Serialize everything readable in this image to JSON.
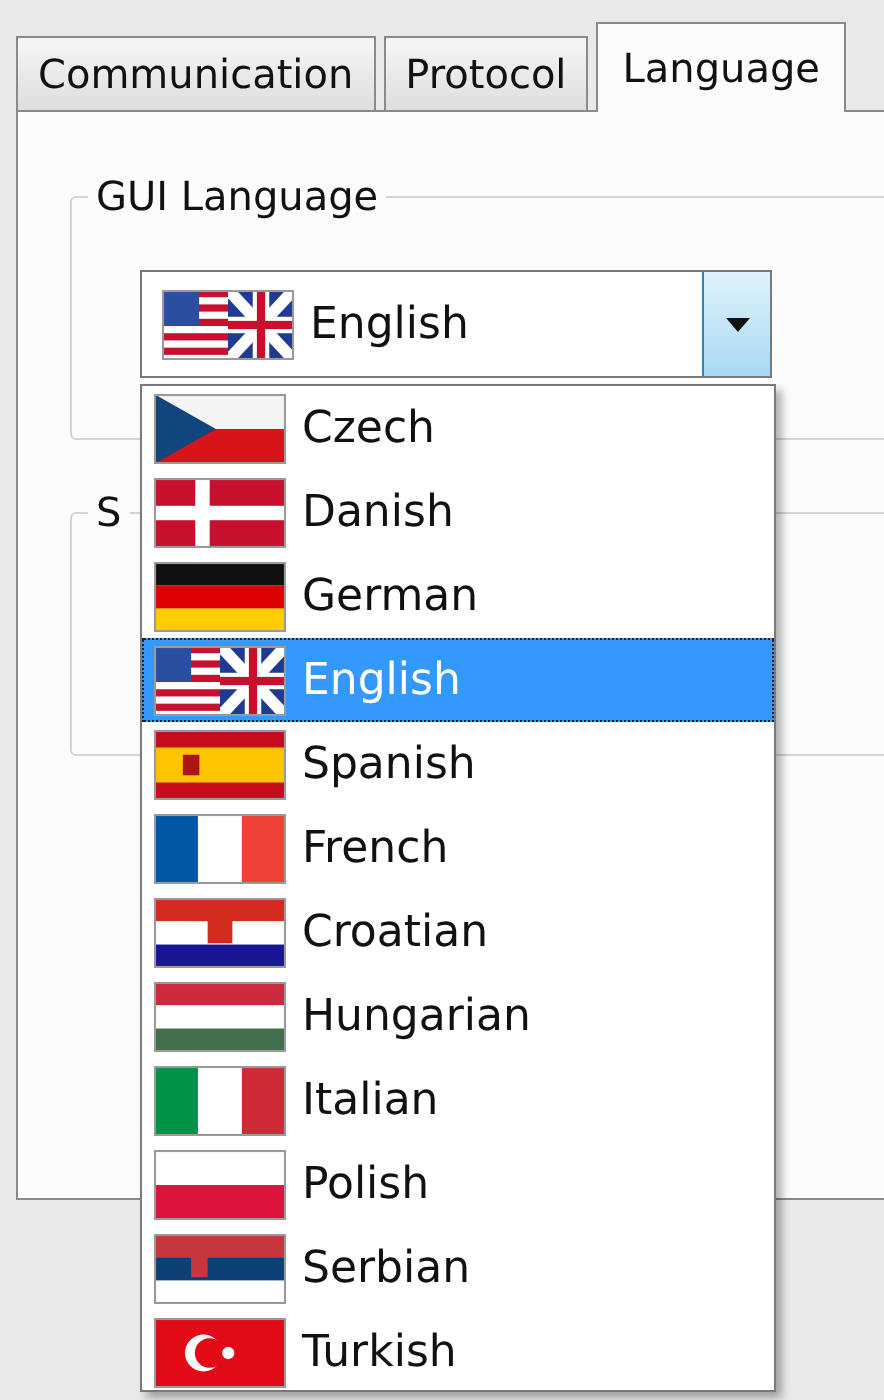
{
  "tabs": [
    {
      "label": "Communication",
      "selected": false
    },
    {
      "label": "Protocol",
      "selected": false
    },
    {
      "label": "Language",
      "selected": true
    }
  ],
  "gui_language": {
    "title": "GUI Language",
    "combo": {
      "value": "English",
      "kind": "en"
    }
  },
  "second_group": {
    "title": "S"
  },
  "dropdown": [
    {
      "label": "Czech",
      "kind": "cz",
      "selected": false
    },
    {
      "label": "Danish",
      "kind": "dk",
      "selected": false
    },
    {
      "label": "German",
      "kind": "de",
      "selected": false
    },
    {
      "label": "English",
      "kind": "en",
      "selected": true
    },
    {
      "label": "Spanish",
      "kind": "es",
      "selected": false
    },
    {
      "label": "French",
      "kind": "fr",
      "selected": false
    },
    {
      "label": "Croatian",
      "kind": "hr",
      "selected": false
    },
    {
      "label": "Hungarian",
      "kind": "hu",
      "selected": false
    },
    {
      "label": "Italian",
      "kind": "it",
      "selected": false
    },
    {
      "label": "Polish",
      "kind": "pl",
      "selected": false
    },
    {
      "label": "Serbian",
      "kind": "rs",
      "selected": false
    },
    {
      "label": "Turkish",
      "kind": "tr",
      "selected": false
    }
  ]
}
